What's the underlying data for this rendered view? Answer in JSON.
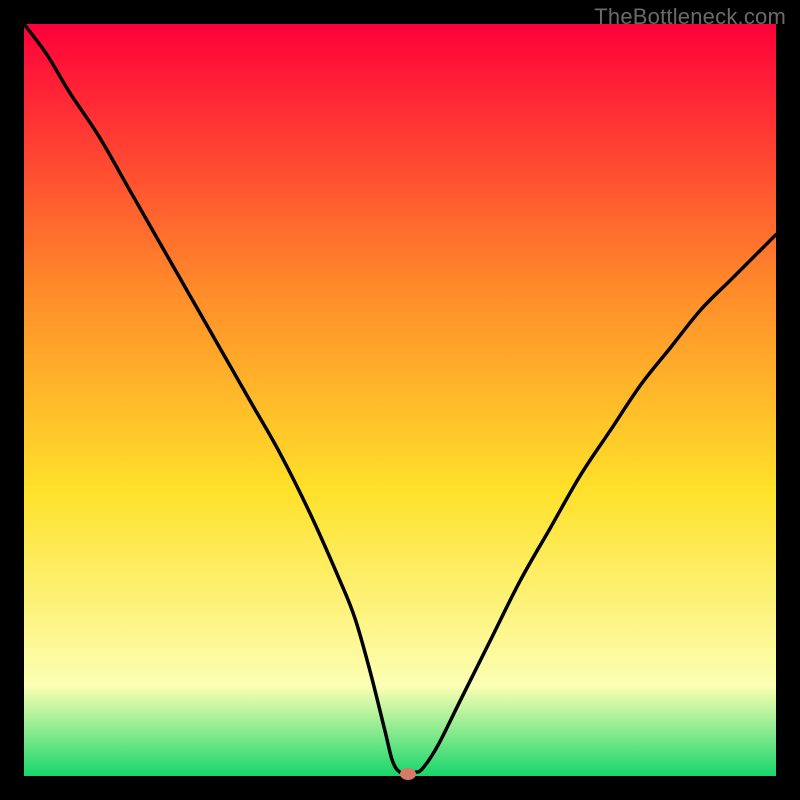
{
  "watermark": "TheBottleneck.com",
  "colors": {
    "frame_border": "#000000",
    "gradient_top": "#ff003a",
    "gradient_mid_upper": "#ff8a2a",
    "gradient_mid": "#ffe12a",
    "gradient_lower": "#fcffb3",
    "gradient_bottom": "#17d66b",
    "curve": "#000000",
    "marker": "#d77a63"
  },
  "chart_data": {
    "type": "line",
    "title": "",
    "xlabel": "",
    "ylabel": "",
    "xlim": [
      0,
      100
    ],
    "ylim": [
      0,
      100
    ],
    "x": [
      0,
      3,
      6,
      10,
      14,
      18,
      22,
      26,
      30,
      34,
      38,
      42,
      44,
      46,
      48,
      49,
      50,
      51,
      52,
      53,
      55,
      58,
      62,
      66,
      70,
      74,
      78,
      82,
      86,
      90,
      94,
      98,
      100
    ],
    "y": [
      100,
      96,
      91,
      85,
      78,
      71,
      64,
      57,
      50,
      43,
      35,
      26,
      21,
      14,
      6,
      2,
      0.5,
      0.5,
      0.5,
      1,
      4,
      10,
      18,
      26,
      33,
      40,
      46,
      52,
      57,
      62,
      66,
      70,
      72
    ],
    "marker": {
      "x": 51,
      "y": 0.3
    },
    "annotations": [],
    "grid": false,
    "legend": false
  }
}
